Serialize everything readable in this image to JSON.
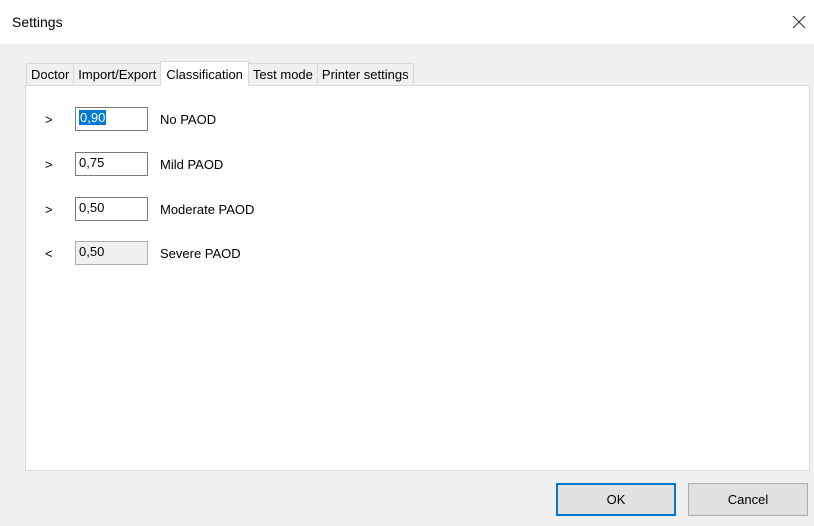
{
  "window": {
    "title": "Settings"
  },
  "tabs": [
    {
      "label": "Doctor",
      "active": false
    },
    {
      "label": "Import/Export",
      "active": false
    },
    {
      "label": "Classification",
      "active": true
    },
    {
      "label": "Test mode",
      "active": false
    },
    {
      "label": "Printer settings",
      "active": false
    }
  ],
  "classification": {
    "rows": [
      {
        "operator": ">",
        "value": "0,90",
        "label": "No PAOD",
        "editable": true,
        "selected": true
      },
      {
        "operator": ">",
        "value": "0,75",
        "label": "Mild PAOD",
        "editable": true,
        "selected": false
      },
      {
        "operator": ">",
        "value": "0,50",
        "label": "Moderate PAOD",
        "editable": true,
        "selected": false
      },
      {
        "operator": "<",
        "value": "0,50",
        "label": "Severe PAOD",
        "editable": false,
        "selected": false
      }
    ]
  },
  "buttons": {
    "ok_label": "OK",
    "cancel_label": "Cancel"
  },
  "colors": {
    "accent": "#0078d7",
    "dialog_bg": "#f0f0f0",
    "panel_bg": "#ffffff",
    "border": "#d9d9d9"
  },
  "icons": {
    "close": "close-icon"
  }
}
